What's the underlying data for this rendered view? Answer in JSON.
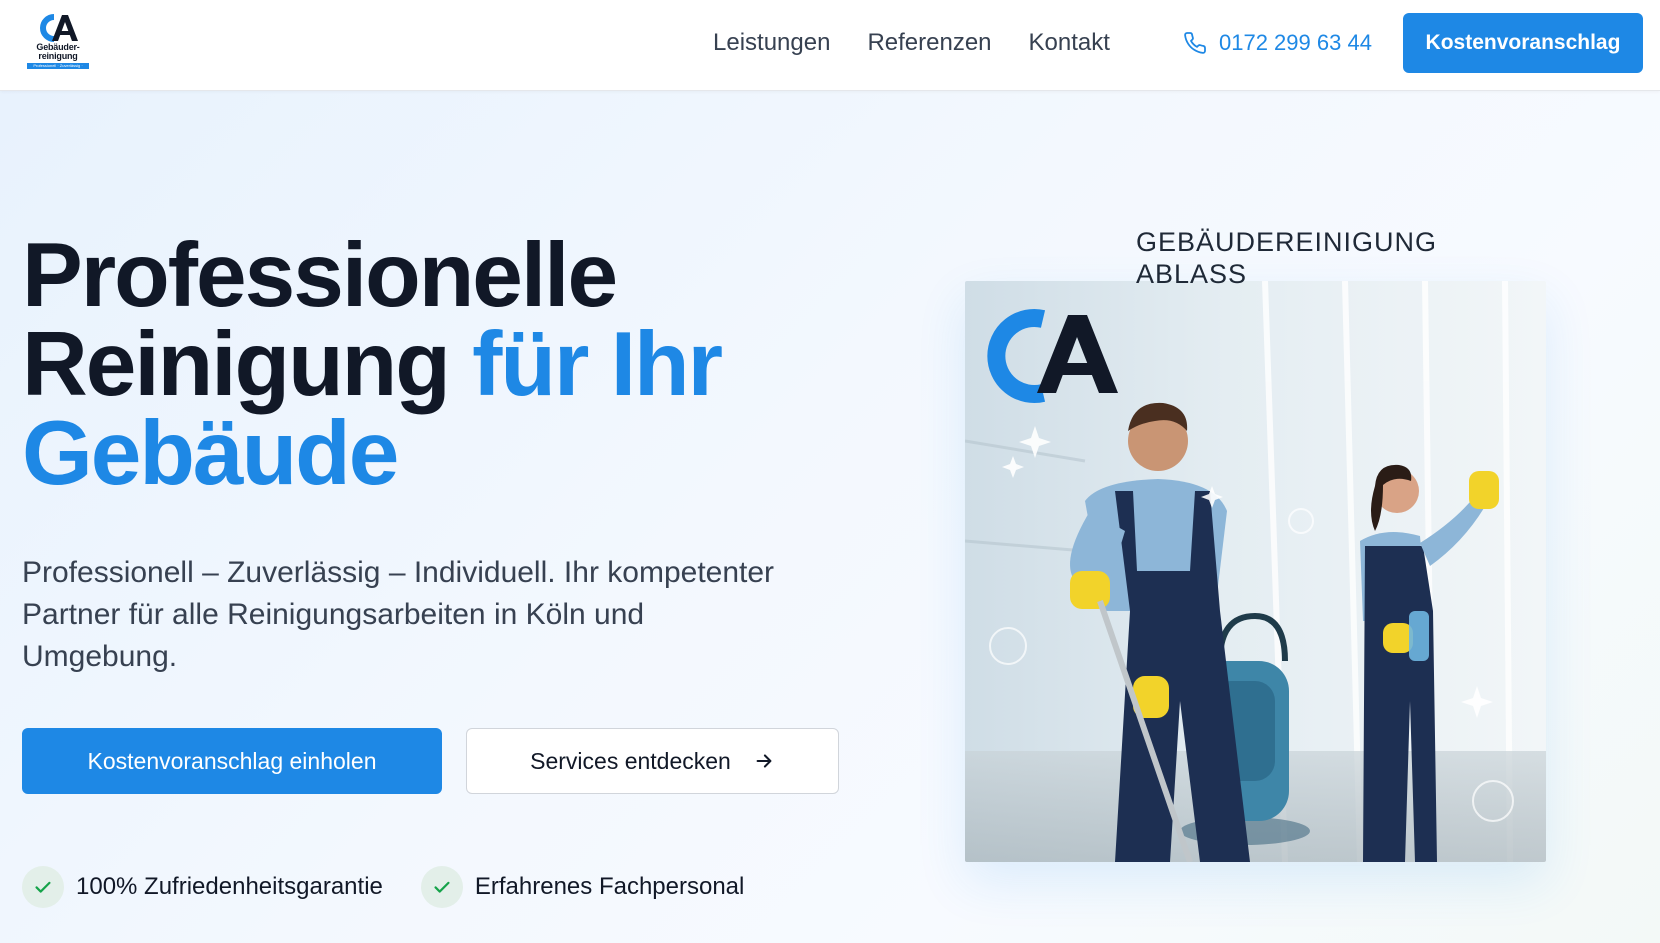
{
  "header": {
    "logo": {
      "line1": "Gebäuder-",
      "line2": "reinigung",
      "tagline": "Professionell · Zuverlässig · Individuell"
    },
    "nav": [
      {
        "label": "Leistungen"
      },
      {
        "label": "Referenzen"
      },
      {
        "label": "Kontakt"
      }
    ],
    "phone": "0172 299 63 44",
    "cta_label": "Kostenvoranschlag"
  },
  "hero": {
    "title_line1": "Professionelle",
    "title_line2_dark": "Reinigung",
    "title_line2_accent": "für Ihr",
    "title_line3_accent": "Gebäude",
    "subtitle": "Professionell – Zuverlässig – Individuell. Ihr kompetenter Partner für alle Reinigungsarbeiten in Köln und Umgebung.",
    "primary_button": "Kostenvoranschlag einholen",
    "secondary_button": "Services entdecken",
    "badges": [
      {
        "label": "100% Zufriedenheitsgarantie"
      },
      {
        "label": "Erfahrenes Fachpersonal"
      }
    ],
    "image": {
      "brand_line1": "GEBÄUDEREINIGUNG",
      "brand_line2": "ABLASS"
    }
  },
  "colors": {
    "accent": "#1e88e5",
    "text_dark": "#111827",
    "text_body": "#374151",
    "check_green": "#16a34a"
  },
  "icons": {
    "phone": "phone-icon",
    "arrow": "arrow-right-icon",
    "check": "check-icon"
  }
}
